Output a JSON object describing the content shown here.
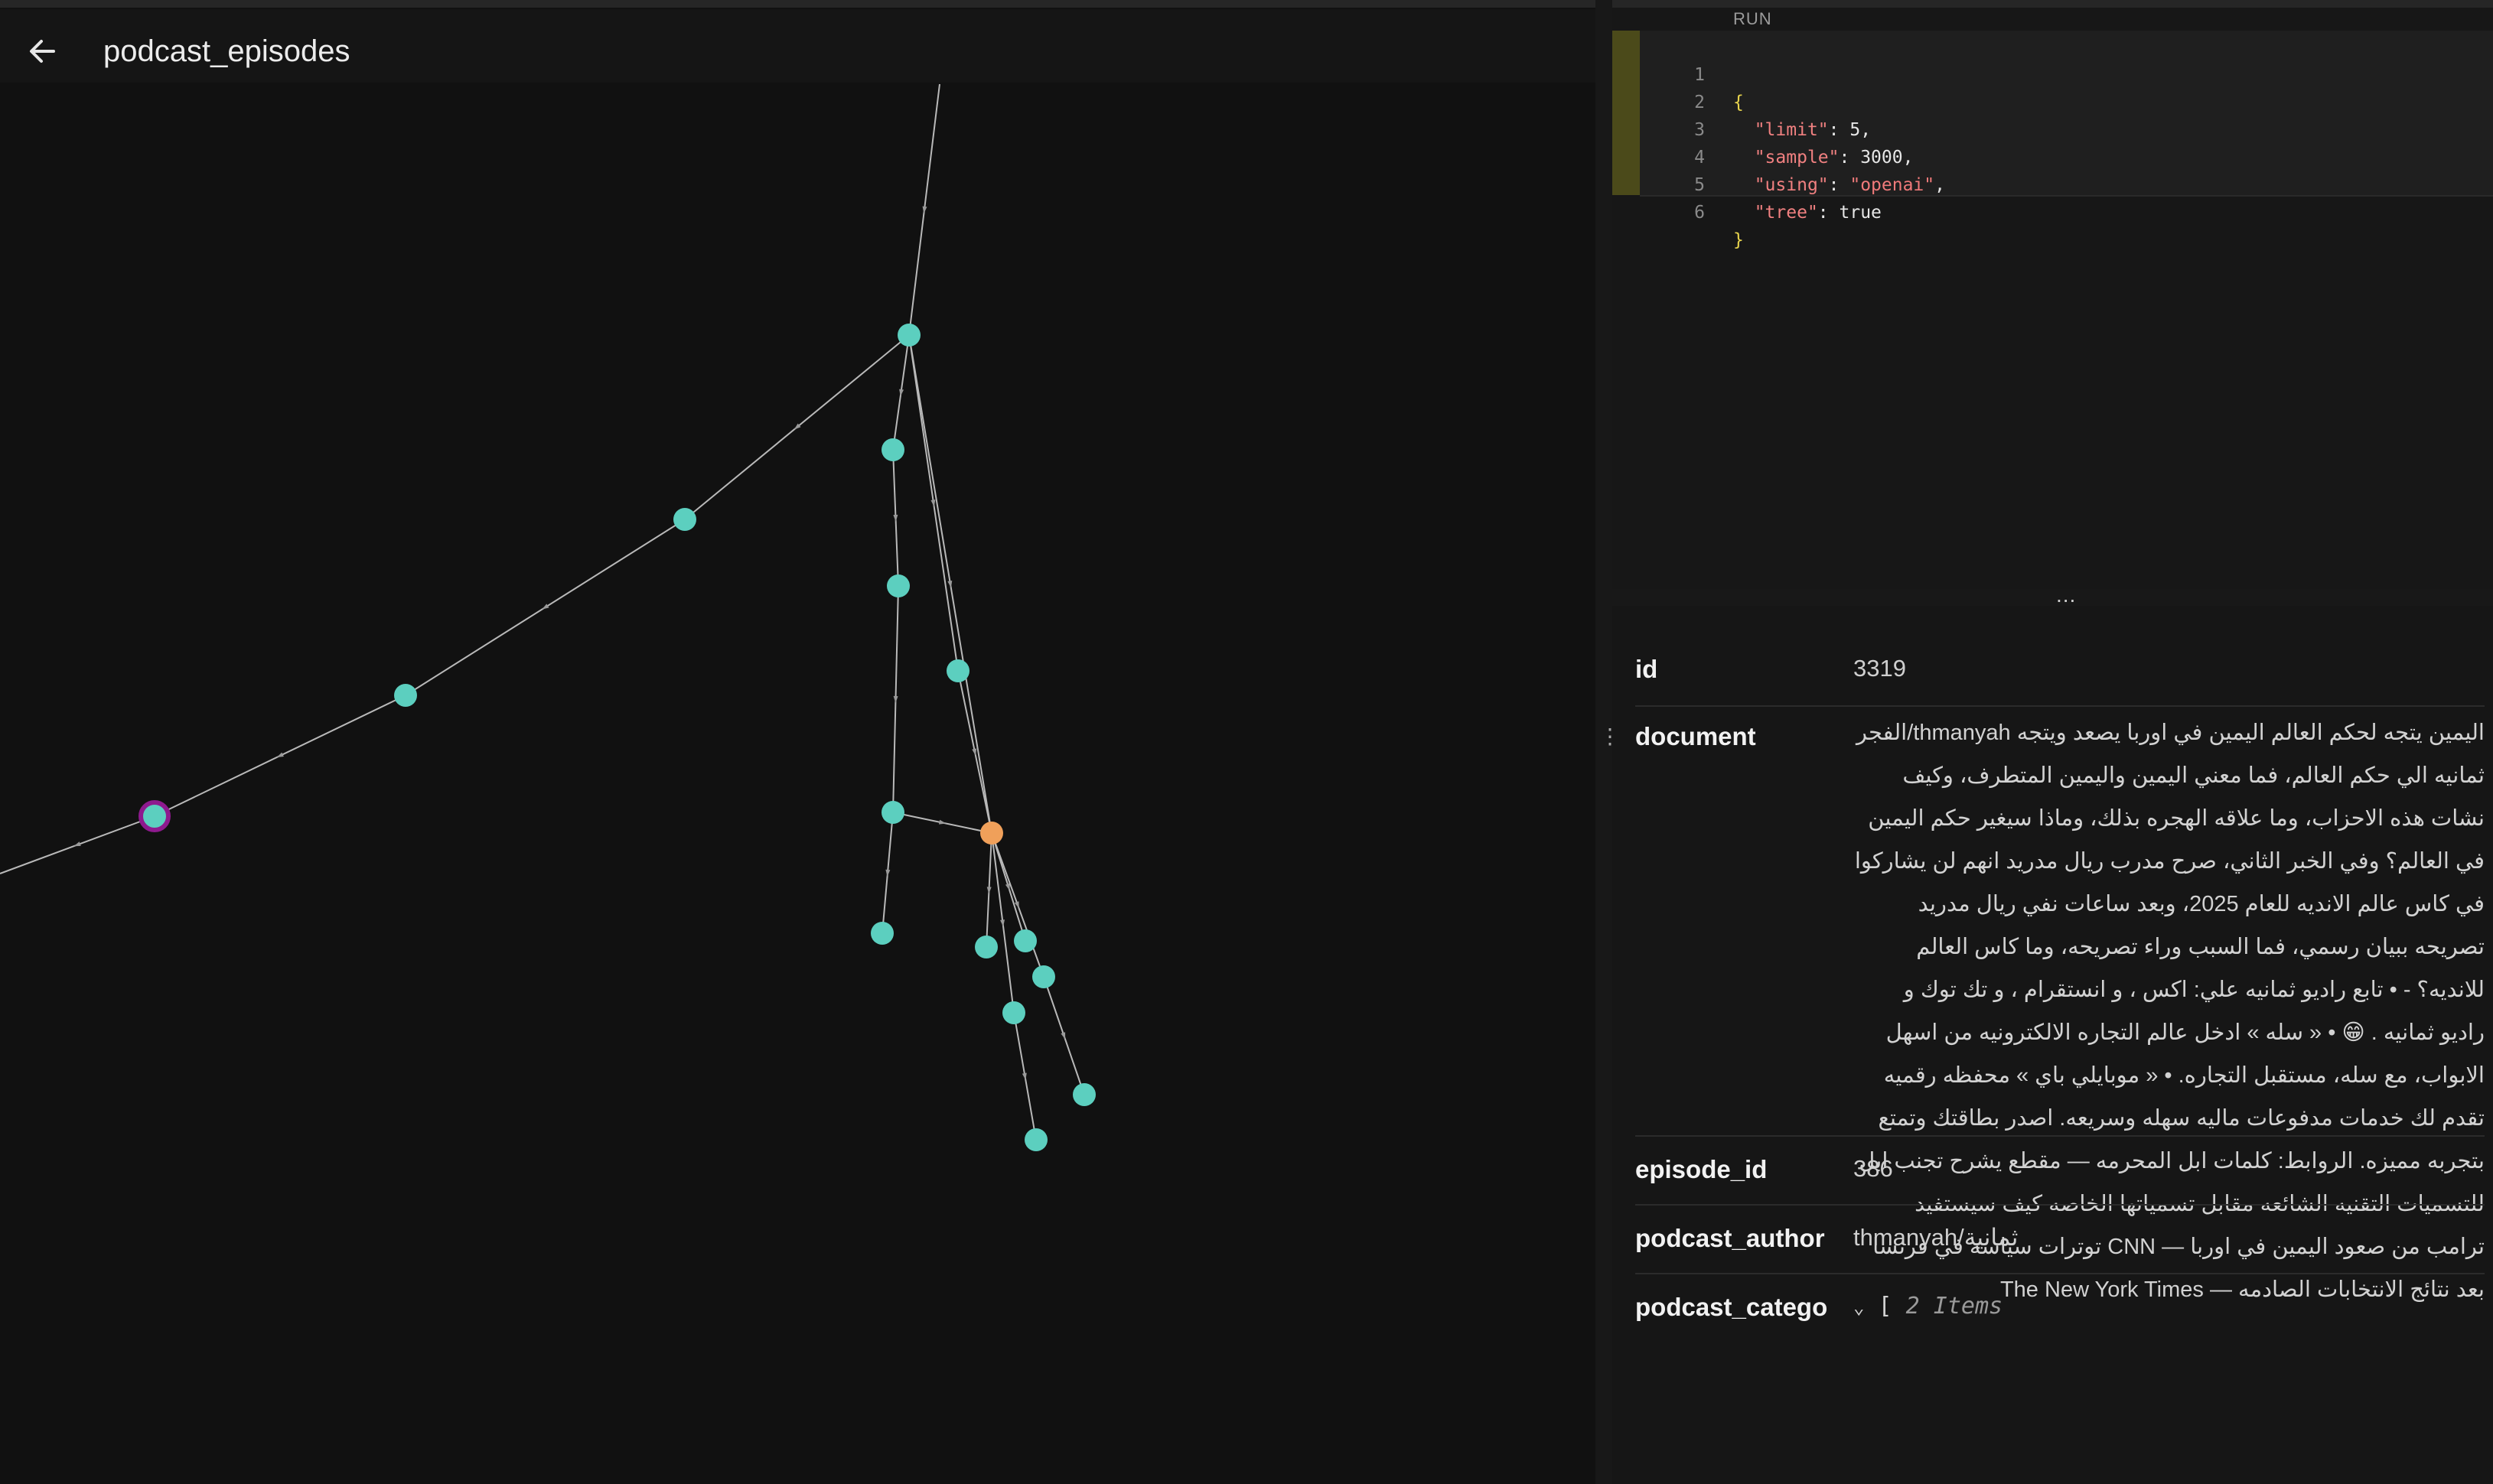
{
  "header": {
    "title": "podcast_episodes",
    "back_icon": "arrow-left-icon"
  },
  "graph": {
    "node_color": "#5ccfbf",
    "highlight_color": "#f0a05a",
    "selected_ring_color": "#8e1a8e",
    "edge_color": "#b9b9b9"
  },
  "editor": {
    "run_label": "RUN",
    "lines": [
      {
        "n": "1"
      },
      {
        "n": "2"
      },
      {
        "n": "3"
      },
      {
        "n": "4"
      },
      {
        "n": "5"
      },
      {
        "n": "6"
      }
    ],
    "open_brace": "{",
    "close_brace": "}",
    "limit_key": "\"limit\"",
    "limit_value": "5",
    "sample_key": "\"sample\"",
    "sample_value": "3000",
    "using_key": "\"using\"",
    "using_value": "\"openai\"",
    "tree_key": "\"tree\"",
    "tree_value": "true"
  },
  "divider": {
    "grip": "⋮",
    "dots": "..."
  },
  "record": {
    "id_label": "id",
    "id_value": "3319",
    "document_label": "document",
    "document_value": "اليمين يتجه لحكم العالم اليمين في اوربا يصعد ويتجه thmanyah/الفجر ثمانيه الي حكم العالم، فما معني اليمين واليمين المتطرف، وكيف نشات هذه الاحزاب، وما علاقه الهجره بذلك، وماذا سيغير حكم اليمين في العالم؟ وفي الخبر الثاني، صرح مدرب ريال مدريد انهم لن يشاركوا في كاس عالم الانديه للعام 2025، وبعد ساعات نفي ريال مدريد تصريحه ببيان رسمي، فما السبب وراء تصريحه، وما كاس العالم للانديه؟ - • تابع راديو ثمانيه علي: اكس ، و انستقرام ، و تك توك و راديو ثمانيه . 😁 • « سله » ادخل عالم التجاره الالكترونيه من اسهل الابواب، مع سله، مستقبل التجاره. • « موبايلي باي » محفظه رقميه تقدم لك خدمات مدفوعات ماليه سهله وسريعه. اصدر بطاقتك وتمتع بتجربه مميزه. الروابط: كلمات ابل المحرمه — مقطع يشرح تجنب ابل للتسميات التقنيه الشائعه مقابل تسمياتها الخاصه كيف سيستفيد ترامب من صعود اليمين في اوربا — CNN توترات سياسه في فرنسا بعد نتائج الانتخابات الصادمه — The New York Times",
    "episode_id_label": "episode_id",
    "episode_id_value": "386",
    "podcast_author_label": "podcast_author",
    "podcast_author_value": "thmanyah/ثمانية",
    "podcast_category_label": "podcast_catego",
    "podcast_category_chevron": "⌄",
    "podcast_category_bracket": "[",
    "podcast_category_count": "2 Items"
  }
}
